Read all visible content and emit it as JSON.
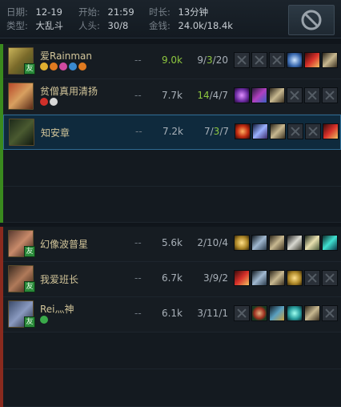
{
  "header": {
    "date_label": "日期:",
    "date_value": "12-19",
    "start_label": "开始:",
    "start_value": "21:59",
    "duration_label": "时长:",
    "duration_value": "13分钟",
    "type_label": "类型:",
    "type_value": "大乱斗",
    "kills_label": "人头:",
    "kills_value": "30/8",
    "gold_label": "金钱:",
    "gold_value": "24.0k/18.4k"
  },
  "friend_badge": "友",
  "colors": {
    "team1_bar": "#3a8a1e",
    "team2_bar": "#8a2a1e",
    "highlight_green": "#8dc63f",
    "name_gold": "#d2c59a"
  },
  "team1": {
    "players": [
      {
        "name": "爱Rainman",
        "dash": "--",
        "gold": "9.0k",
        "kda_k": "9",
        "kda_d": "3",
        "kda_a": "20",
        "champion_icon": "champion-portrait-1",
        "is_friend": true,
        "gold_highlight": true,
        "highlight": "d",
        "tags": [
          "gold-badge-icon",
          "orange-badge-icon",
          "pink-badge-icon",
          "blue-badge-icon",
          "orange-badge-icon"
        ],
        "items": [
          "empty",
          "empty",
          "empty",
          "ice-gauntlet-item-icon",
          "red-blade-item-icon",
          "boots-item-icon"
        ]
      },
      {
        "name": "贫僧真用清扬",
        "dash": "--",
        "gold": "7.7k",
        "kda_k": "14",
        "kda_d": "4",
        "kda_a": "7",
        "champion_icon": "champion-portrait-2",
        "is_friend": false,
        "gold_highlight": false,
        "highlight": "k",
        "tags": [
          "red-badge-icon",
          "white-badge-icon"
        ],
        "items": [
          "purple-tome-item-icon",
          "crystal-scepter-item-icon",
          "boots-item-icon",
          "empty",
          "empty",
          "empty"
        ]
      },
      {
        "name": "知安章",
        "dash": "--",
        "gold": "7.2k",
        "kda_k": "7",
        "kda_d": "3",
        "kda_a": "7",
        "champion_icon": "champion-portrait-3",
        "is_friend": false,
        "gold_highlight": false,
        "highlight": "d",
        "tags": [],
        "items": [
          "red-orb-item-icon",
          "blue-sword-item-icon",
          "boots-item-icon",
          "empty",
          "empty",
          "red-blade-item-icon"
        ]
      }
    ]
  },
  "team2": {
    "players": [
      {
        "name": "幻像波普星",
        "dash": "--",
        "gold": "5.6k",
        "kda_k": "2",
        "kda_d": "10",
        "kda_a": "4",
        "champion_icon": "champion-portrait-4",
        "is_friend": true,
        "gold_highlight": false,
        "highlight": "",
        "tags": [],
        "items": [
          "gold-gauntlet-item-icon",
          "broadsword-item-icon",
          "boots-item-icon",
          "silver-claw-item-icon",
          "blade-item-icon",
          "teal-blade-item-icon"
        ]
      },
      {
        "name": "我爱班长",
        "dash": "--",
        "gold": "6.7k",
        "kda_k": "3",
        "kda_d": "9",
        "kda_a": "2",
        "champion_icon": "champion-portrait-5",
        "is_friend": true,
        "gold_highlight": false,
        "highlight": "",
        "tags": [],
        "items": [
          "red-blade-item-icon",
          "broadsword-item-icon",
          "boots-item-icon",
          "gold-gauntlet-item-icon",
          "empty",
          "empty"
        ]
      },
      {
        "name": "Rei灬神",
        "dash": "--",
        "gold": "6.1k",
        "kda_k": "3",
        "kda_d": "11",
        "kda_a": "1",
        "champion_icon": "champion-portrait-6",
        "is_friend": true,
        "gold_highlight": false,
        "highlight": "",
        "tags": [
          "green-shield-badge-icon"
        ],
        "items": [
          "empty",
          "red-amulet-item-icon",
          "arrow-item-icon",
          "teal-scythe-item-icon",
          "boots-item-icon",
          "empty"
        ]
      }
    ]
  }
}
